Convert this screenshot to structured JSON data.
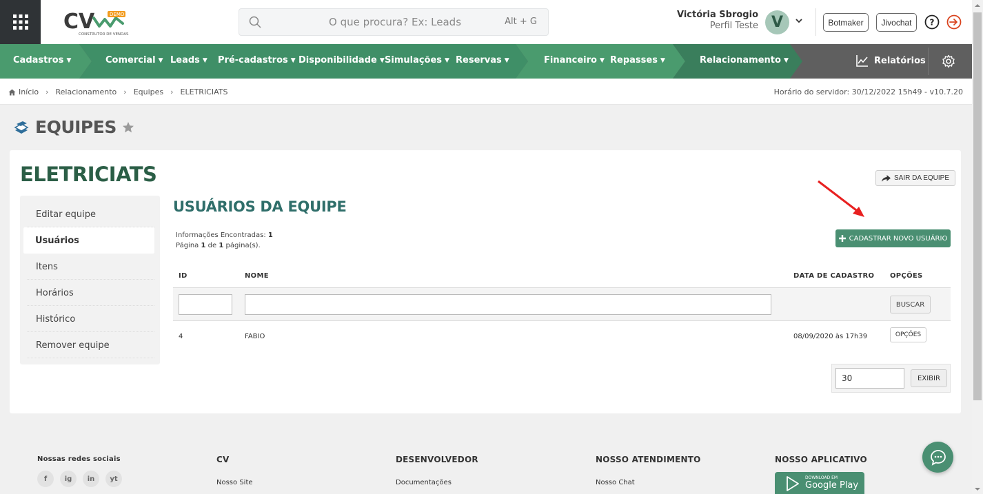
{
  "header": {
    "search_placeholder": "O que procura? Ex: Leads",
    "search_shortcut": "Alt + G",
    "user_name": "Victória Sbrogio",
    "user_profile": "Perfil Teste",
    "avatar_letter": "V",
    "botmaker_label": "Botmaker",
    "jivochat_label": "Jivochat",
    "logo_text": "CV",
    "logo_badge": "DEMO",
    "logo_subtitle": "CONSTRUTOR DE VENDAS"
  },
  "nav": {
    "items": [
      {
        "label": "Cadastros"
      },
      {
        "label": "Comercial"
      },
      {
        "label": "Leads"
      },
      {
        "label": "Pré-cadastros"
      },
      {
        "label": "Disponibilidade"
      },
      {
        "label": "Simulações"
      },
      {
        "label": "Reservas"
      },
      {
        "label": "Financeiro"
      },
      {
        "label": "Repasses"
      },
      {
        "label": "Relacionamento"
      }
    ],
    "reports_label": "Relatórios",
    "colors": {
      "green_1": "#4a9b6e",
      "green_2": "#3f8f67",
      "green_3": "#4a9b6e",
      "green_4": "#3a7e5c",
      "gray": "#5f5f5f"
    }
  },
  "breadcrumb": {
    "items": [
      "Início",
      "Relacionamento",
      "Equipes",
      "ELETRICIATS"
    ],
    "server_time": "Horário do servidor: 30/12/2022 15h49 - v10.7.20"
  },
  "page": {
    "title": "EQUIPES"
  },
  "team": {
    "name": "ELETRICIATS",
    "leave_label": "SAIR DA EQUIPE",
    "menu": [
      {
        "label": "Editar equipe"
      },
      {
        "label": "Usuários"
      },
      {
        "label": "Itens"
      },
      {
        "label": "Horários"
      },
      {
        "label": "Histórico"
      },
      {
        "label": "Remover equipe"
      }
    ]
  },
  "users_section": {
    "title": "USUÁRIOS DA EQUIPE",
    "info_found_label": "Informações Encontradas:",
    "info_found_count": "1",
    "page_word": "Página",
    "page_current": "1",
    "page_of": "de",
    "page_total": "1",
    "page_suffix": "página(s).",
    "new_user_label": "CADASTRAR NOVO USUÁRIO",
    "columns": [
      "ID",
      "NOME",
      "DATA DE CADASTRO",
      "OPÇÕES"
    ],
    "search_label": "BUSCAR",
    "rows": [
      {
        "id": "4",
        "name": "FABIO",
        "date": "08/09/2020 às 17h39",
        "options_label": "OPÇÕES"
      }
    ],
    "per_page_value": "30",
    "show_label": "EXIBIR"
  },
  "footer": {
    "social_title": "Nossas redes sociais",
    "social": [
      "f",
      "ig",
      "in",
      "yt"
    ],
    "cols": [
      {
        "title": "CV",
        "link": "Nosso Site"
      },
      {
        "title": "DESENVOLVEDOR",
        "link": "Documentações"
      },
      {
        "title": "NOSSO ATENDIMENTO",
        "link": "Nosso Chat"
      },
      {
        "title": "NOSSO APLICATIVO"
      }
    ],
    "gplay_small": "DOWNLOAD EM",
    "gplay_big": "Google Play"
  }
}
